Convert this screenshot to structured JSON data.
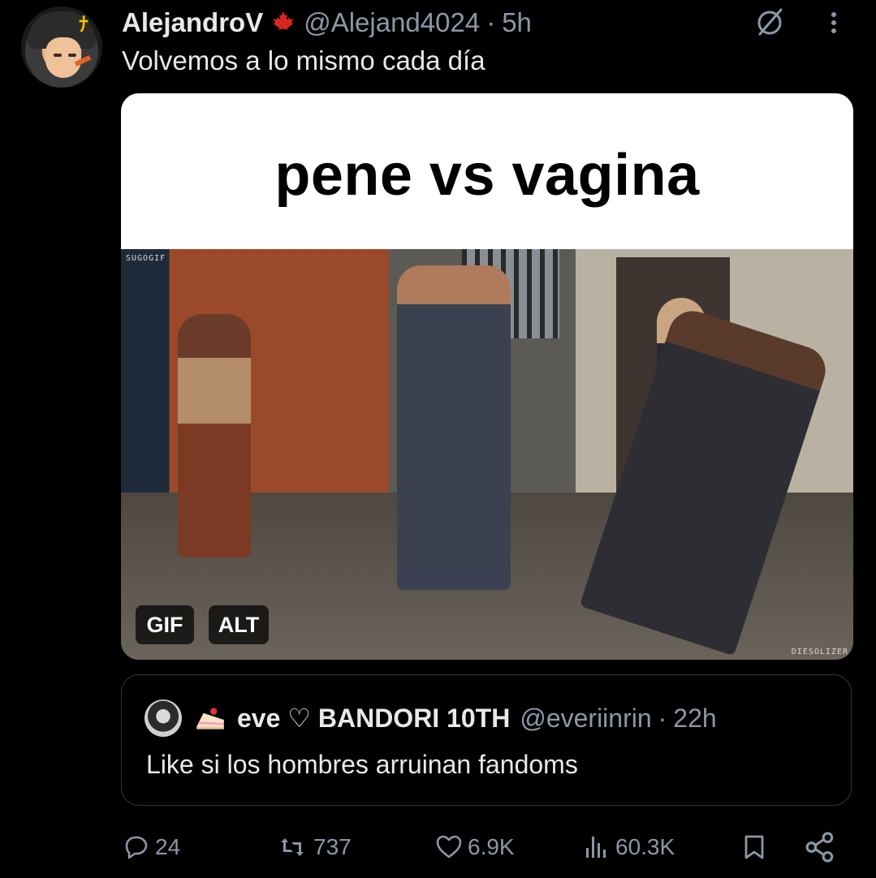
{
  "tweet": {
    "author_name": "AlejandroV",
    "handle": "@Alejand4024",
    "separator": "·",
    "time": "5h",
    "text": "Volvemos a lo mismo cada día"
  },
  "media": {
    "caption": "pene vs vagina",
    "watermark_top": "SUGOGIF",
    "watermark_bottom": "DIESOLIZER",
    "badges": {
      "gif": "GIF",
      "alt": "ALT"
    }
  },
  "quote": {
    "name": "eve ♡ BANDORI 10TH",
    "handle": "@everiinrin",
    "separator": "·",
    "time": "22h",
    "text": "Like si los hombres arruinan fandoms"
  },
  "actions": {
    "replies": "24",
    "reposts": "737",
    "likes": "6.9K",
    "views": "60.3K"
  },
  "icons": [
    "maple-leaf-icon",
    "grok-icon",
    "more-icon",
    "cake-icon",
    "reply-icon",
    "repost-icon",
    "like-icon",
    "views-icon",
    "bookmark-icon",
    "share-icon"
  ]
}
